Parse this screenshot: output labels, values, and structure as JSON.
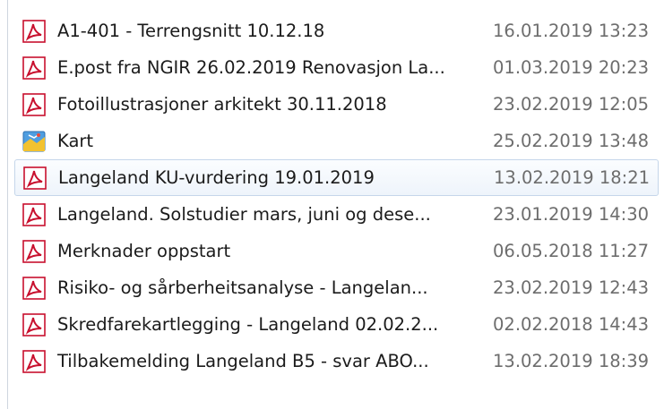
{
  "files": [
    {
      "name": "A1-401 - Terrengsnitt 10.12.18",
      "modified": "16.01.2019 13:23",
      "icon": "pdf-icon"
    },
    {
      "name": "E.post fra NGIR 26.02.2019 Renovasjon La...",
      "modified": "01.03.2019 20:23",
      "icon": "pdf-icon"
    },
    {
      "name": "Fotoillustrasjoner arkitekt 30.11.2018",
      "modified": "23.02.2019 12:05",
      "icon": "pdf-icon"
    },
    {
      "name": "Kart",
      "modified": "25.02.2019 13:48",
      "icon": "map-icon"
    },
    {
      "name": "Langeland KU-vurdering 19.01.2019",
      "modified": "13.02.2019 18:21",
      "icon": "pdf-icon"
    },
    {
      "name": "Langeland. Solstudier mars, juni og dese...",
      "modified": "23.01.2019 14:30",
      "icon": "pdf-icon"
    },
    {
      "name": "Merknader oppstart",
      "modified": "06.05.2018 11:27",
      "icon": "pdf-icon"
    },
    {
      "name": "Risiko- og sårberheitsanalyse - Langelan...",
      "modified": "23.02.2019 12:43",
      "icon": "pdf-icon"
    },
    {
      "name": "Skredfarekartlegging - Langeland 02.02.2...",
      "modified": "02.02.2018 14:43",
      "icon": "pdf-icon"
    },
    {
      "name": "Tilbakemelding Langeland B5 - svar ABO...",
      "modified": "13.02.2019 18:39",
      "icon": "pdf-icon"
    }
  ],
  "colors": {
    "pdf_red": "#c8102e",
    "hover_border": "#c5d6ea",
    "date_text": "#6d6d6d"
  }
}
